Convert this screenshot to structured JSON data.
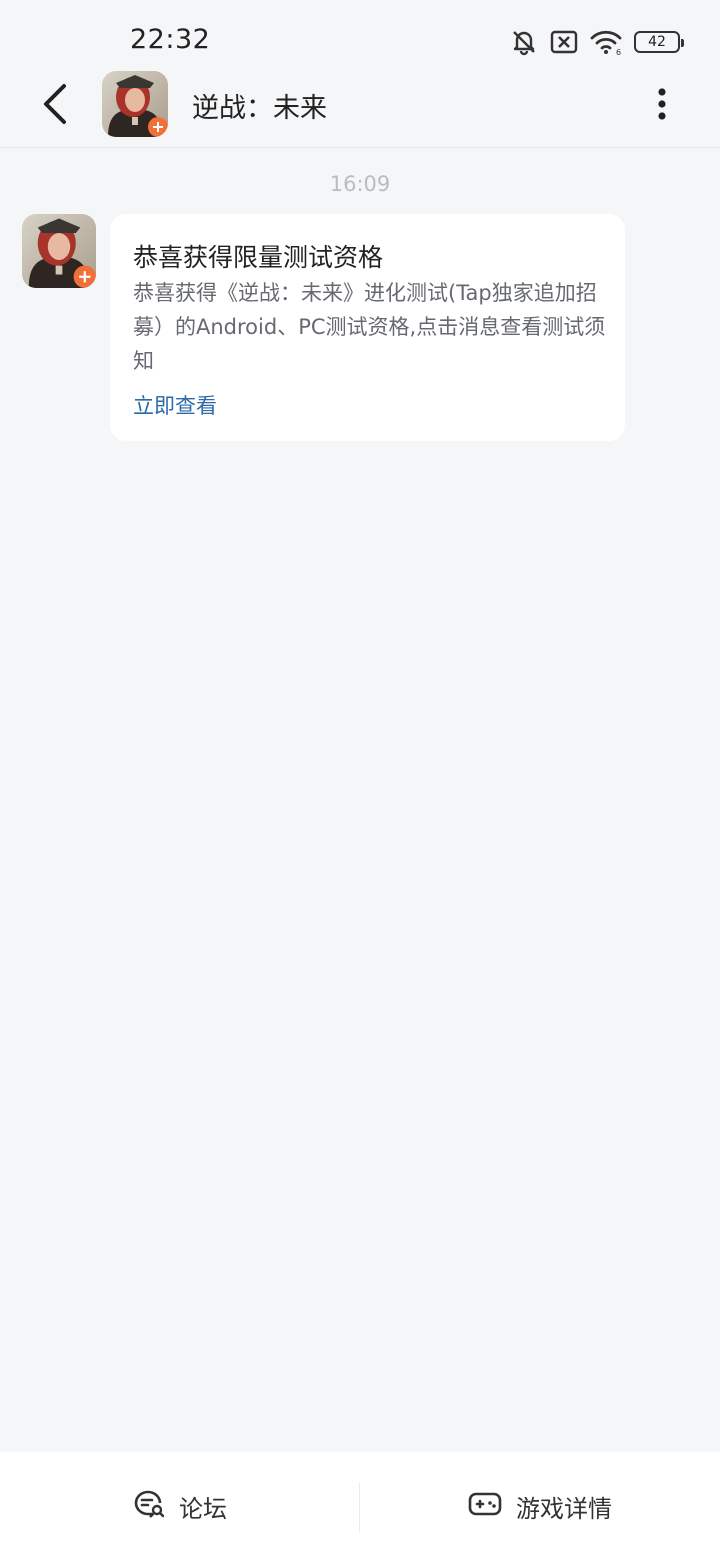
{
  "status_bar": {
    "time": "22:32",
    "battery": "42",
    "icons": [
      "bell-muted-icon",
      "sim-off-icon",
      "wifi-icon",
      "battery-icon"
    ]
  },
  "nav": {
    "title": "逆战：未来",
    "back_icon": "chevron-left-icon",
    "more_icon": "more-vertical-icon"
  },
  "chat": {
    "timestamp": "16:09",
    "message": {
      "title": "恭喜获得限量测试资格",
      "body": "恭喜获得《逆战：未来》进化测试(Tap独家追加招募）的Android、PC测试资格,点击消息查看测试须知",
      "link": "立即查看"
    }
  },
  "bottom_bar": {
    "tabs": [
      {
        "label": "论坛",
        "icon": "forum-icon"
      },
      {
        "label": "游戏详情",
        "icon": "gamepad-icon"
      }
    ]
  },
  "colors": {
    "background": "#f5f6f8",
    "card": "#ffffff",
    "link": "#2c6aa8",
    "timestamp": "#b9bcc1"
  }
}
